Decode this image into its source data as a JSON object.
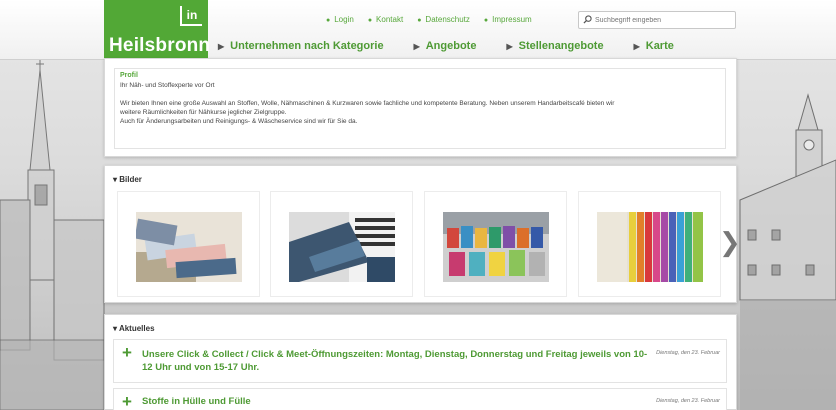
{
  "brand": {
    "name": "Heilsbronn",
    "mark": "in",
    "color": "#52a836"
  },
  "header": {
    "top_links": [
      "Login",
      "Kontakt",
      "Datenschutz",
      "Impressum"
    ],
    "search_placeholder": "Suchbegriff eingeben",
    "nav": [
      "Unternehmen nach Kategorie",
      "Angebote",
      "Stellenangebote",
      "Karte"
    ]
  },
  "profil": {
    "title": "Profil",
    "lines": [
      "Ihr Näh- und Stoffexperte vor Ort",
      "",
      "Wir bieten Ihnen eine große Auswahl an Stoffen, Wolle, Nähmaschinen & Kurzwaren sowie fachliche und kompetente Beratung. Neben unserem Handarbeitscafé bieten wir",
      "weitere Räumlichkeiten für Nähkurse jeglicher Zielgruppe.",
      "Auch für Änderungsarbeiten und Reinigungs- & Wäscheservice sind wir für Sie da."
    ]
  },
  "bilder": {
    "title": "▾ Bilder",
    "images": [
      {
        "alt": "fabric-stack-image"
      },
      {
        "alt": "person-with-fabric-image"
      },
      {
        "alt": "thread-spools-image"
      },
      {
        "alt": "colored-fabric-rolls-image"
      }
    ],
    "next_icon": "chevron-right-icon"
  },
  "aktuelles": {
    "title": "▾ Aktuelles",
    "items": [
      {
        "title_line1": "Unsere Click & Collect / Click & Meet-Öffnungszeiten: Montag, Dienstag, Donnerstag und Freitag jeweils von 10-",
        "title_line2": "12 Uhr und von 15-17 Uhr.",
        "date": "Dienstag, den 23. Februar"
      },
      {
        "title_line1": "Stoffe in Hülle und Fülle",
        "title_line2": "",
        "date": "Dienstag, den 23. Februar"
      }
    ]
  },
  "colors": {
    "accent": "#4e9a34",
    "text": "#333333",
    "page_bg": "#d9d9d9"
  }
}
